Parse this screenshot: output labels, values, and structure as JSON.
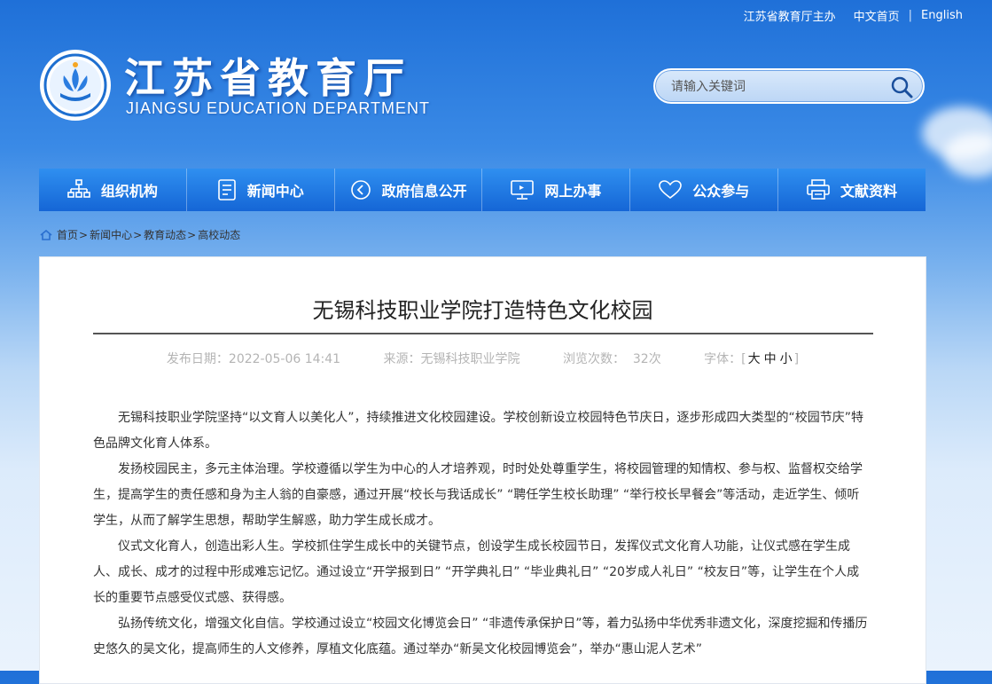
{
  "topbar": {
    "sponsor": "江苏省教育厅主办",
    "home": "中文首页",
    "english": "English"
  },
  "logo": {
    "cn": "江苏省教育厅",
    "en": "JIANGSU EDUCATION DEPARTMENT"
  },
  "search": {
    "placeholder": "请输入关键词"
  },
  "nav": {
    "items": [
      {
        "label": "组织机构",
        "icon": "org-icon"
      },
      {
        "label": "新闻中心",
        "icon": "news-icon"
      },
      {
        "label": "政府信息公开",
        "icon": "info-icon"
      },
      {
        "label": "网上办事",
        "icon": "computer-icon"
      },
      {
        "label": "公众参与",
        "icon": "heart-icon"
      },
      {
        "label": "文献资料",
        "icon": "printer-icon"
      }
    ]
  },
  "breadcrumb": {
    "items": [
      "首页",
      "新闻中心",
      "教育动态",
      "高校动态"
    ]
  },
  "article": {
    "title": "无锡科技职业学院打造特色文化校园",
    "date_label": "发布日期：2022-05-06 14:41",
    "source_label": "来源：无锡科技职业学院",
    "views_label": "浏览次数：  32次",
    "font_label": "字体：",
    "font_large": "大",
    "font_medium": "中",
    "font_small": "小",
    "paragraphs": [
      "无锡科技职业学院坚持“以文育人以美化人”，持续推进文化校园建设。学校创新设立校园特色节庆日，逐步形成四大类型的“校园节庆”特色品牌文化育人体系。",
      "发扬校园民主，多元主体治理。学校遵循以学生为中心的人才培养观，时时处处尊重学生，将校园管理的知情权、参与权、监督权交给学生，提高学生的责任感和身为主人翁的自豪感，通过开展“校长与我话成长” “聘任学生校长助理” “举行校长早餐会”等活动，走近学生、倾听学生，从而了解学生思想，帮助学生解惑，助力学生成长成才。",
      "仪式文化育人，创造出彩人生。学校抓住学生成长中的关键节点，创设学生成长校园节日，发挥仪式文化育人功能，让仪式感在学生成人、成长、成才的过程中形成难忘记忆。通过设立“开学报到日” “开学典礼日” “毕业典礼日” “20岁成人礼日” “校友日”等，让学生在个人成长的重要节点感受仪式感、获得感。",
      "弘扬传统文化，增强文化自信。学校通过设立“校园文化博览会日” “非遗传承保护日”等，着力弘扬中华优秀非遗文化，深度挖掘和传播历史悠久的吴文化，提高师生的人文修养，厚植文化底蕴。通过举办“新吴文化校园博览会”，举办“惠山泥人艺术”"
    ]
  },
  "colors": {
    "nav_top": "#2f8ff0",
    "nav_bottom": "#1566d6",
    "title_text": "#222222",
    "meta_text": "#b4b4b4"
  }
}
